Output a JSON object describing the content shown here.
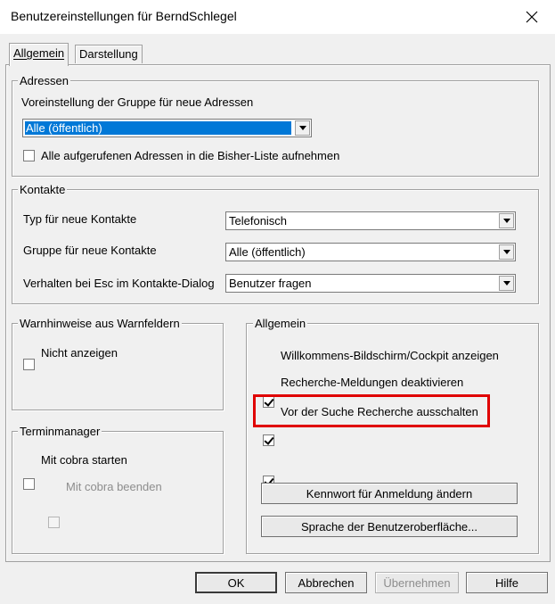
{
  "window": {
    "title": "Benutzereinstellungen für BerndSchlegel",
    "close_icon": "close-icon"
  },
  "tabs": [
    {
      "label": "Allgemein",
      "active": true
    },
    {
      "label": "Darstellung",
      "active": false
    }
  ],
  "adressen": {
    "legend": "Adressen",
    "group_label": "Voreinstellung der Gruppe für neue Adressen",
    "group_value": "Alle (öffentlich)",
    "checkbox_label": "Alle aufgerufenen Adressen in die Bisher-Liste aufnehmen",
    "checkbox_checked": false
  },
  "kontakte": {
    "legend": "Kontakte",
    "typ_label": "Typ für neue Kontakte",
    "typ_value": "Telefonisch",
    "gruppe_label": "Gruppe für neue Kontakte",
    "gruppe_value": "Alle (öffentlich)",
    "esc_label": "Verhalten bei Esc im Kontakte-Dialog",
    "esc_value": "Benutzer fragen"
  },
  "warnhinweise": {
    "legend": "Warnhinweise aus Warnfeldern",
    "checkbox_label": "Nicht anzeigen",
    "checkbox_checked": false
  },
  "terminmanager": {
    "legend": "Terminmanager",
    "start_label": "Mit cobra starten",
    "start_checked": false,
    "end_label": "Mit cobra beenden",
    "end_checked": false
  },
  "allgemein": {
    "legend": "Allgemein",
    "welcome_label": "Willkommens-Bildschirm/Cockpit anzeigen",
    "welcome_checked": true,
    "recherche_label": "Recherche-Meldungen deaktivieren",
    "recherche_checked": true,
    "suche_label": "Vor der Suche Recherche ausschalten",
    "suche_checked": true,
    "password_button": "Kennwort für Anmeldung ändern",
    "language_button": "Sprache der Benutzeroberfläche..."
  },
  "footer": {
    "ok": "OK",
    "abbrechen": "Abbrechen",
    "uebernehmen": "Übernehmen",
    "hilfe": "Hilfe"
  },
  "colors": {
    "highlight": "#e00000",
    "selection": "#0078d7"
  }
}
